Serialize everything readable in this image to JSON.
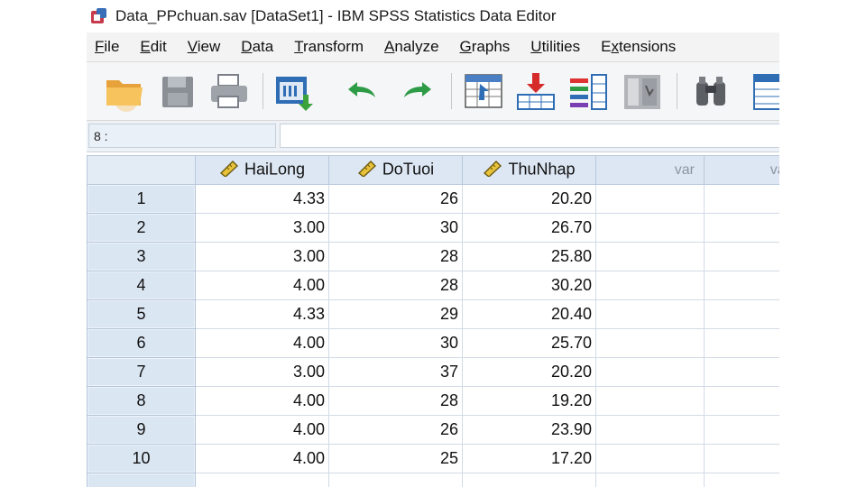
{
  "window": {
    "title": "Data_PPchuan.sav [DataSet1] - IBM SPSS Statistics Data Editor"
  },
  "menu": [
    {
      "first": "F",
      "rest": "ile"
    },
    {
      "first": "E",
      "rest": "dit"
    },
    {
      "first": "V",
      "rest": "iew"
    },
    {
      "first": "D",
      "rest": "ata"
    },
    {
      "first": "T",
      "rest": "ransform"
    },
    {
      "first": "A",
      "rest": "nalyze"
    },
    {
      "first": "G",
      "rest": "raphs"
    },
    {
      "first": "U",
      "rest": "tilities"
    },
    {
      "first": "x",
      "rest": "tensions",
      "prefix": "E"
    }
  ],
  "toolbar_icons": [
    "open-folder-icon",
    "save-icon",
    "print-icon",
    "recall-dialog-icon",
    "undo-icon",
    "redo-icon",
    "goto-case-icon",
    "goto-variable-icon",
    "variables-icon",
    "run-descriptives-icon",
    "find-icon",
    "split-file-icon"
  ],
  "refbar": {
    "cell_ref": "8 :",
    "value": ""
  },
  "grid": {
    "columns": [
      "HaiLong",
      "DoTuoi",
      "ThuNhap",
      "var",
      "var"
    ],
    "rows": [
      {
        "n": "1",
        "HaiLong": "4.33",
        "DoTuoi": "26",
        "ThuNhap": "20.20"
      },
      {
        "n": "2",
        "HaiLong": "3.00",
        "DoTuoi": "30",
        "ThuNhap": "26.70"
      },
      {
        "n": "3",
        "HaiLong": "3.00",
        "DoTuoi": "28",
        "ThuNhap": "25.80"
      },
      {
        "n": "4",
        "HaiLong": "4.00",
        "DoTuoi": "28",
        "ThuNhap": "30.20"
      },
      {
        "n": "5",
        "HaiLong": "4.33",
        "DoTuoi": "29",
        "ThuNhap": "20.40"
      },
      {
        "n": "6",
        "HaiLong": "4.00",
        "DoTuoi": "30",
        "ThuNhap": "25.70"
      },
      {
        "n": "7",
        "HaiLong": "3.00",
        "DoTuoi": "37",
        "ThuNhap": "20.20"
      },
      {
        "n": "8",
        "HaiLong": "4.00",
        "DoTuoi": "28",
        "ThuNhap": "19.20"
      },
      {
        "n": "9",
        "HaiLong": "4.00",
        "DoTuoi": "26",
        "ThuNhap": "23.90"
      },
      {
        "n": "10",
        "HaiLong": "4.00",
        "DoTuoi": "25",
        "ThuNhap": "17.20"
      }
    ]
  },
  "colors": {
    "header_bg": "#dde7f3",
    "row_header_bg": "#dbe6f3",
    "var_text": "#8c96a3"
  }
}
